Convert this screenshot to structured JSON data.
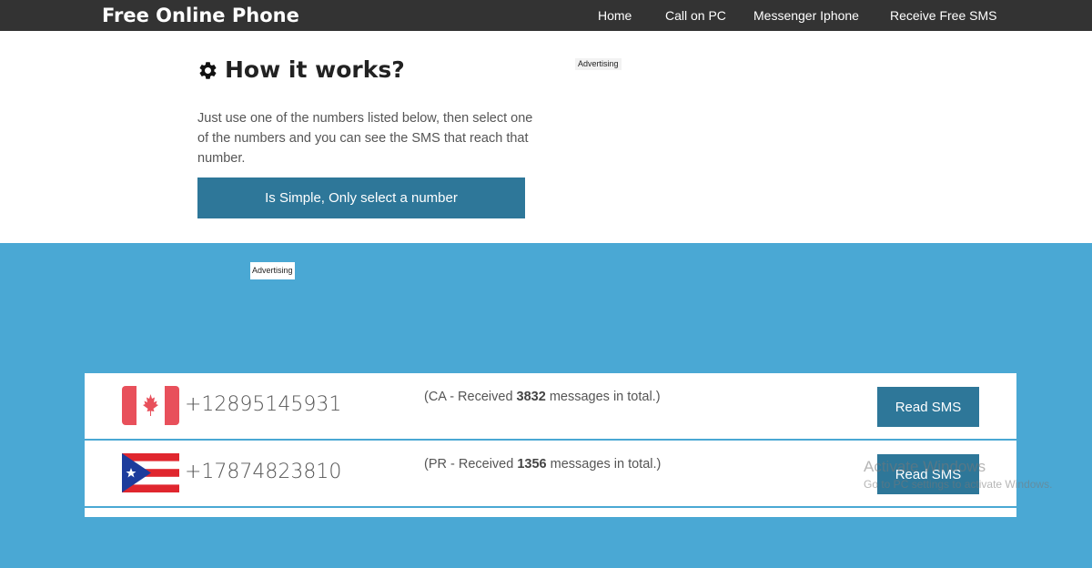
{
  "navbar": {
    "brand": "Free Online Phone",
    "items": [
      {
        "label": "Home"
      },
      {
        "label": "Call on PC"
      },
      {
        "label": "Messenger Iphone"
      },
      {
        "label": "Receive Free SMS"
      }
    ]
  },
  "how_it_works": {
    "icon": "gear-icon",
    "title": "How it works?",
    "description": "Just use one of the numbers listed below, then select one of the numbers and you can see the SMS that reach that number.",
    "cta_label": "Is Simple, Only select a number"
  },
  "ads": {
    "top_label": "Advertising",
    "blue_label": "Advertising"
  },
  "numbers": [
    {
      "flag": "canada-flag-icon",
      "phone": "+12895145931",
      "info_prefix": "(CA - Received ",
      "count": "3832",
      "info_suffix": " messages in total.)",
      "button": "Read SMS"
    },
    {
      "flag": "puerto-rico-flag-icon",
      "phone": "+17874823810",
      "info_prefix": "(PR - Received ",
      "count": "1356",
      "info_suffix": " messages in total.)",
      "button": "Read SMS"
    }
  ],
  "watermark": {
    "title": "Activate Windows",
    "subtitle": "Go to PC settings to activate Windows."
  },
  "colors": {
    "navbar": "#333333",
    "accent_button": "#2e7799",
    "section_blue": "#4aa8d4"
  }
}
